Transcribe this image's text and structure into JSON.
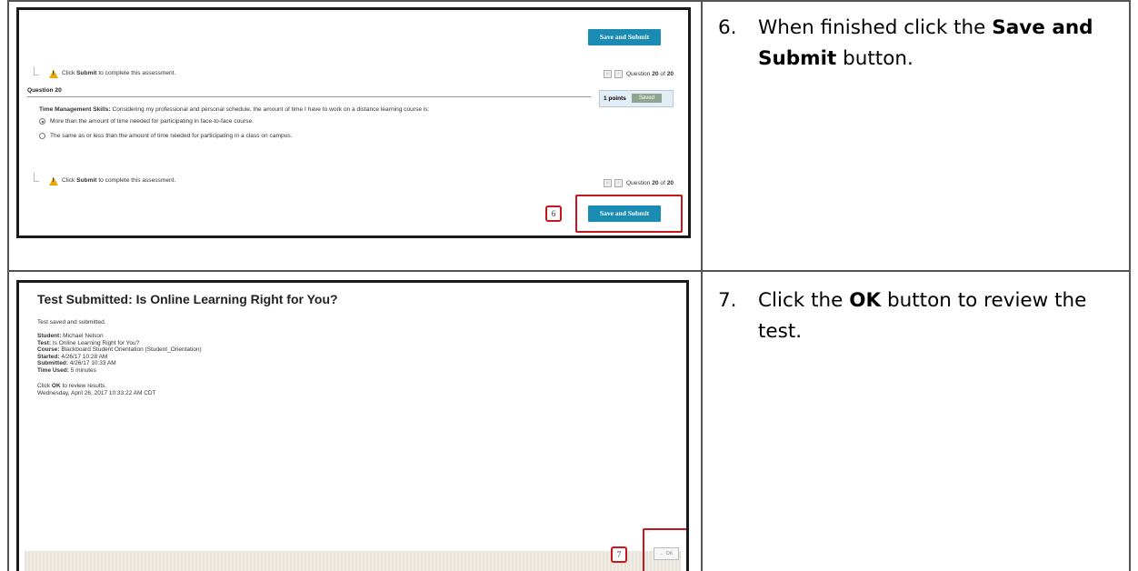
{
  "step6": {
    "shot": {
      "save_submit_top": "Save and Submit",
      "warn_text_pre": "Click ",
      "warn_text_bold": "Submit",
      "warn_text_post": " to complete this assessment.",
      "nav_label_pre": "Question ",
      "nav_current": "20",
      "nav_of": " of ",
      "nav_total": "20",
      "question_heading": "Question 20",
      "points": "1 points",
      "saved": "Saved",
      "prompt_bold": "Time Management Skills:",
      "prompt_rest": " Considering my professional and personal schedule, the amount of time I have to work on a distance learning course is:",
      "options": [
        "More than the amount of time needed for participating in face-to-face course.",
        "The same as or less than the amount of time needed for participating in a class on campus."
      ],
      "selected_option": 0,
      "save_submit_bottom": "Save and Submit",
      "badge": "6"
    },
    "instruction": {
      "number": "6.",
      "text_pre": "When finished click the ",
      "text_bold": "Save and Submit",
      "text_post": " button."
    }
  },
  "step7": {
    "shot": {
      "title": "Test Submitted: Is Online Learning Right for You?",
      "saved_msg": "Test saved and submitted.",
      "details": [
        {
          "label": "Student:",
          "value": " Michael Nelson"
        },
        {
          "label": "Test:",
          "value": " Is Online Learning Right for You?"
        },
        {
          "label": "Course:",
          "value": " Blackboard Student Orientation (Student_Orientation)"
        },
        {
          "label": "Started:",
          "value": " 4/26/17 10:28 AM"
        },
        {
          "label": "Submitted:",
          "value": " 4/26/17 10:33 AM"
        },
        {
          "label": "Time Used:",
          "value": " 5 minutes"
        }
      ],
      "review_pre": "Click ",
      "review_bold": "OK",
      "review_post": " to review results.",
      "timestamp": "Wednesday, April 26, 2017 10:33:22 AM CDT",
      "ok_label": "OK",
      "badge": "7"
    },
    "instruction": {
      "number": "7.",
      "text_pre": "Click the ",
      "text_bold": "OK",
      "text_post": " button to review the test."
    }
  },
  "colors": {
    "accent_button": "#1a8bb3",
    "callout_red": "#c8161d",
    "warning": "#e8a800"
  }
}
